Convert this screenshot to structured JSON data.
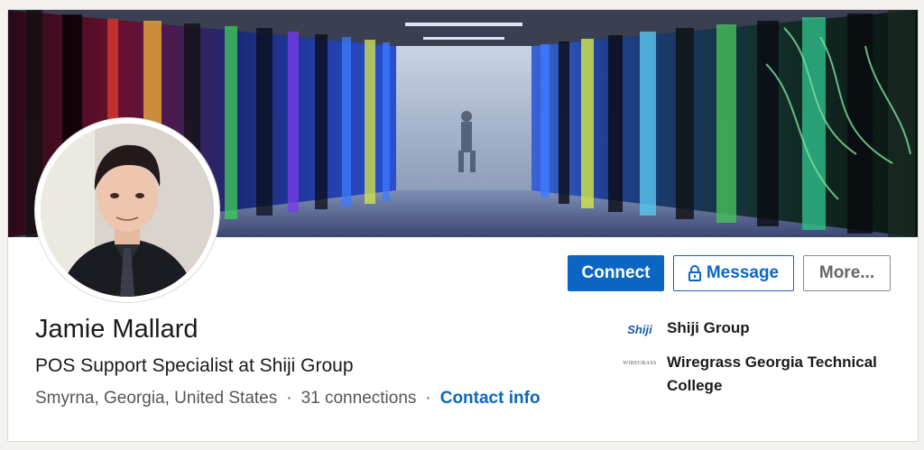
{
  "profile": {
    "name": "Jamie Mallard",
    "headline": "POS Support Specialist at Shiji Group",
    "location": "Smyrna, Georgia, United States",
    "separator": "·",
    "connections": "31 connections",
    "contact_info": "Contact info"
  },
  "actions": {
    "connect": "Connect",
    "message": "Message",
    "more": "More..."
  },
  "organizations": [
    {
      "name": "Shiji Group",
      "logo_text": "Shiji",
      "logo_icon": "shiji-logo"
    },
    {
      "name": "Wiregrass Georgia Technical College",
      "logo_text": "WIREGRASS",
      "logo_icon": "wiregrass-logo"
    }
  ],
  "colors": {
    "accent": "#0a66c2",
    "text": "#1a1a1a",
    "muted": "#555555"
  },
  "banner": {
    "subject": "data-center-server-aisle-photo"
  },
  "avatar": {
    "subject": "profile-photo"
  }
}
